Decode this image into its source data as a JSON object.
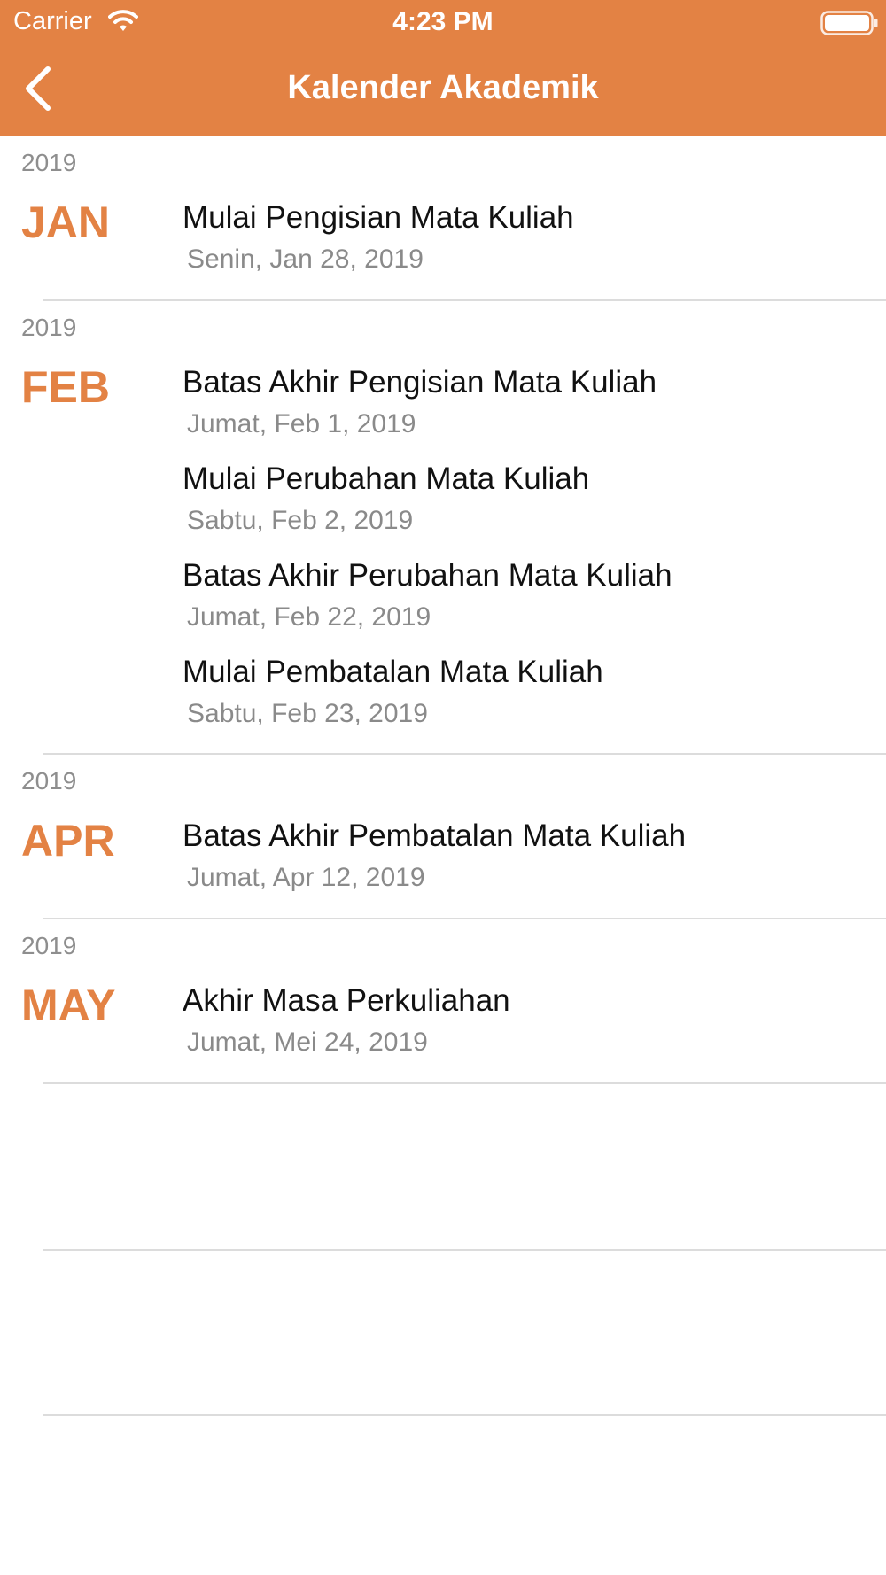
{
  "status_bar": {
    "carrier": "Carrier",
    "time": "4:23 PM",
    "wifi_icon": "wifi-icon",
    "battery_icon": "battery-icon"
  },
  "nav": {
    "back_icon": "chevron-left-icon",
    "title": "Kalender Akademik"
  },
  "colors": {
    "accent": "#E38244",
    "month_text": "#E38244",
    "year_text": "#8e8e8e",
    "event_title": "#111111",
    "event_date": "#8a8a8a",
    "divider": "#dcdcdc"
  },
  "sections": [
    {
      "year": "2019",
      "month": "JAN",
      "events": [
        {
          "title": "Mulai Pengisian Mata Kuliah",
          "date": "Senin, Jan 28, 2019"
        }
      ]
    },
    {
      "year": "2019",
      "month": "FEB",
      "events": [
        {
          "title": "Batas Akhir Pengisian Mata Kuliah",
          "date": "Jumat, Feb 1, 2019"
        },
        {
          "title": "Mulai Perubahan Mata Kuliah",
          "date": "Sabtu, Feb 2, 2019"
        },
        {
          "title": "Batas Akhir Perubahan Mata Kuliah",
          "date": "Jumat, Feb 22, 2019"
        },
        {
          "title": "Mulai Pembatalan Mata Kuliah",
          "date": "Sabtu, Feb 23, 2019"
        }
      ]
    },
    {
      "year": "2019",
      "month": "APR",
      "events": [
        {
          "title": "Batas Akhir Pembatalan Mata Kuliah",
          "date": "Jumat, Apr 12, 2019"
        }
      ]
    },
    {
      "year": "2019",
      "month": "MAY",
      "events": [
        {
          "title": "Akhir Masa Perkuliahan",
          "date": "Jumat, Mei 24, 2019"
        }
      ]
    }
  ]
}
